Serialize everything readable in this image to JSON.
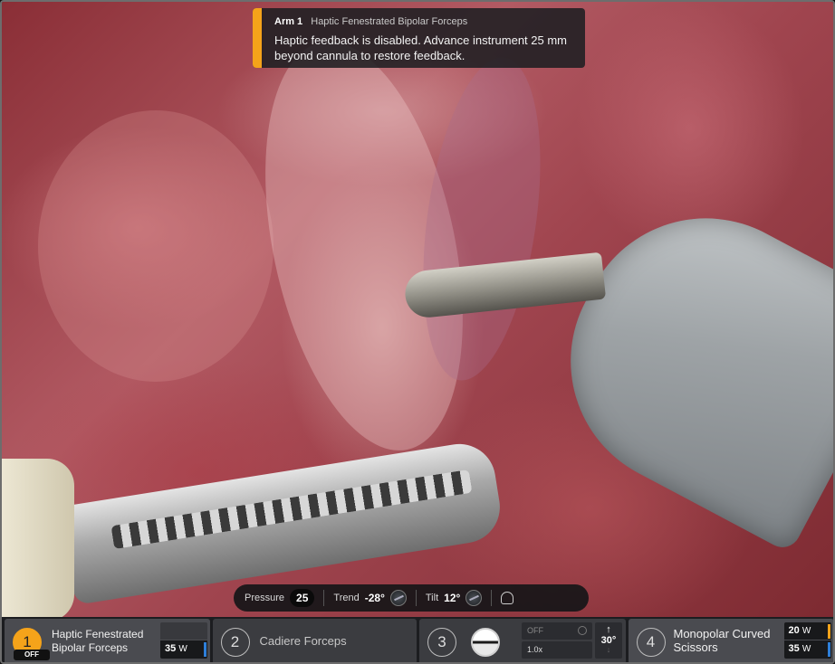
{
  "notification": {
    "arm": "Arm 1",
    "instrument": "Haptic Fenestrated Bipolar Forceps",
    "message": "Haptic feedback is disabled. Advance instrument 25 mm beyond cannula to restore feedback.",
    "accent_color": "#f5a31a"
  },
  "status_bar": {
    "pressure_label": "Pressure",
    "pressure_value": "25",
    "trend_label": "Trend",
    "trend_value": "-28°",
    "tilt_label": "Tilt",
    "tilt_value": "12°",
    "icons": [
      "trend-dial-icon",
      "tilt-dial-icon",
      "bell-icon"
    ]
  },
  "arms": [
    {
      "number": "1",
      "state": "OFF",
      "name": "Haptic Fenestrated Bipolar Forceps",
      "energy_value": "35",
      "energy_unit": "W",
      "energy_color": "#2e7fd9",
      "active_color": "#f5a31a"
    },
    {
      "number": "2",
      "name": "Cadiere Forceps"
    },
    {
      "number": "3",
      "camera_mode": "OFF",
      "zoom": "1.0x",
      "scope_angle": "30°",
      "icons": [
        "scope-icon",
        "gear-icon",
        "up-arrow-icon",
        "down-arrow-icon"
      ]
    },
    {
      "number": "4",
      "name": "Monopolar Curved Scissors",
      "energy_top_value": "20",
      "energy_top_color": "#f5a31a",
      "energy_bottom_value": "35",
      "energy_bottom_color": "#2e7fd9",
      "energy_unit": "W"
    }
  ]
}
